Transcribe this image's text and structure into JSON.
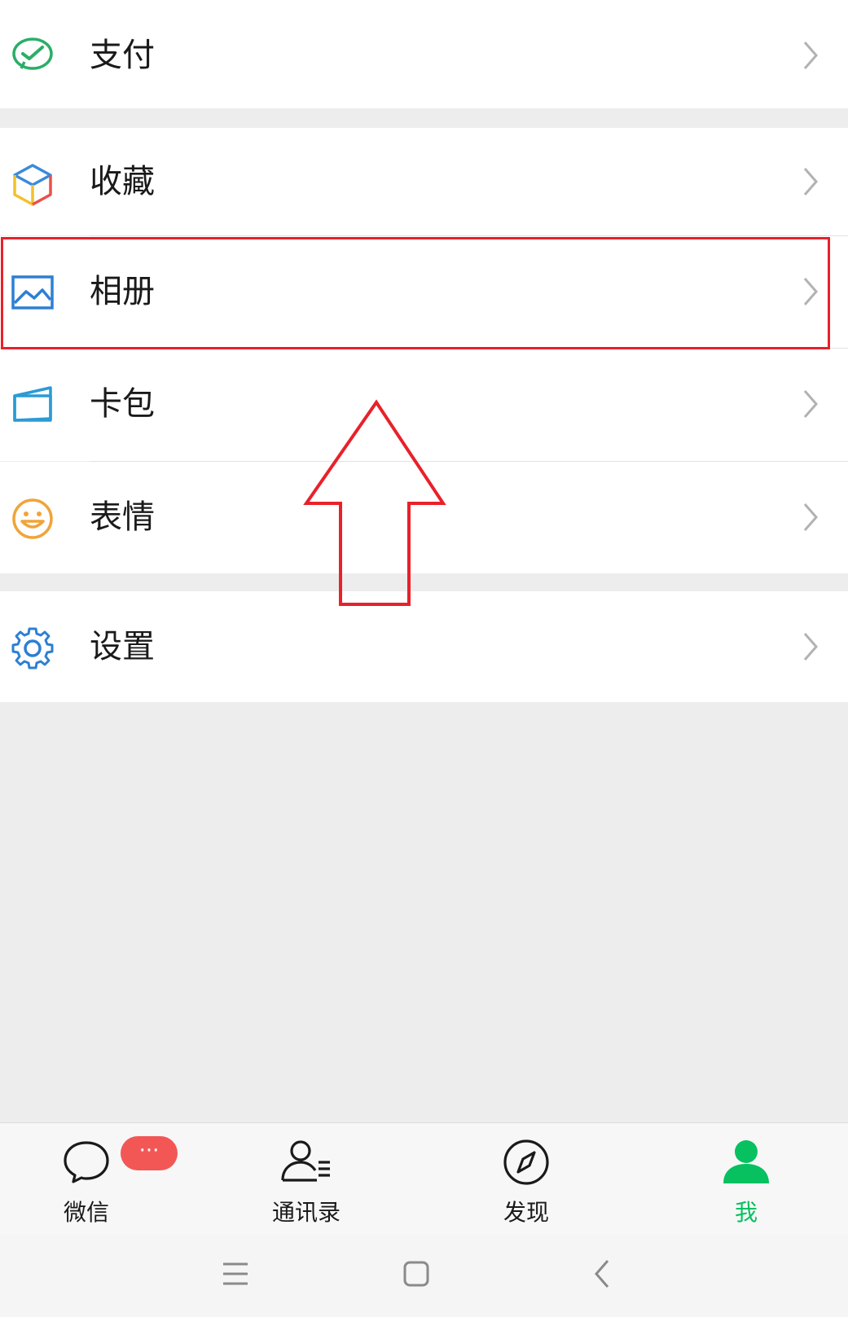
{
  "menu": {
    "pay_label": "支付",
    "favorites_label": "收藏",
    "album_label": "相册",
    "cards_label": "卡包",
    "stickers_label": "表情",
    "settings_label": "设置"
  },
  "tabbar": {
    "chats_label": "微信",
    "chats_badge": "···",
    "contacts_label": "通讯录",
    "discover_label": "发现",
    "me_label": "我"
  },
  "colors": {
    "accent_green": "#07c160",
    "badge_red": "#f25756",
    "annotation_red": "#e8212a"
  },
  "icons": {
    "pay": "wechat-pay-icon",
    "favorites": "cube-icon",
    "album": "picture-icon",
    "cards": "card-wallet-icon",
    "stickers": "smiley-icon",
    "settings": "gear-icon",
    "chevron": "chevron-right-icon",
    "tab_chats": "chat-bubble-icon",
    "tab_contacts": "contacts-icon",
    "tab_discover": "compass-icon",
    "tab_me": "person-icon",
    "nav_menu": "menu-lines-icon",
    "nav_home": "square-home-icon",
    "nav_back": "back-chevron-icon"
  }
}
